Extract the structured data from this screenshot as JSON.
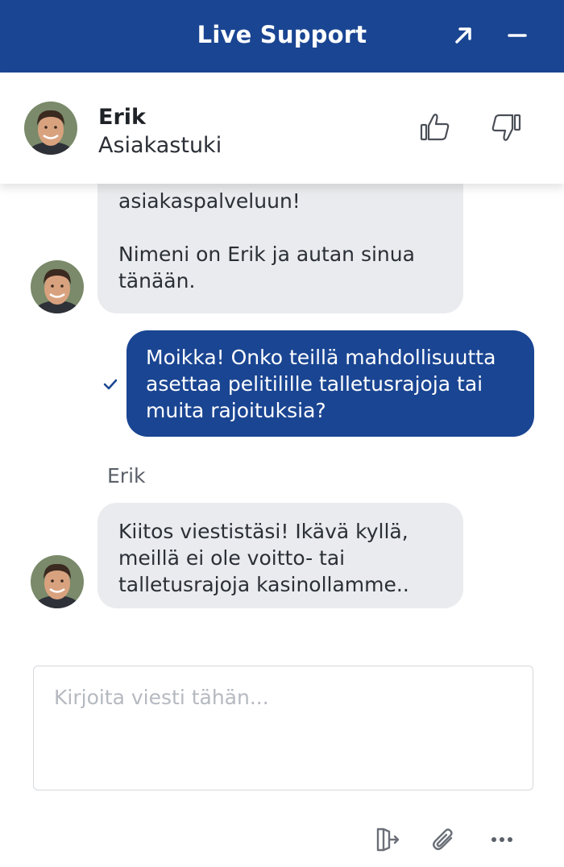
{
  "header": {
    "title": "Live Support",
    "icons": {
      "expand": "expand-arrow-icon",
      "minimize": "minimize-icon"
    },
    "background_color": "#1a4592"
  },
  "agent": {
    "name": "Erik",
    "role": "Asiakastuki",
    "icons": {
      "thumbs_up": "thumbs-up-icon",
      "thumbs_down": "thumbs-down-icon"
    }
  },
  "messages": [
    {
      "from": "agent",
      "lines": [
        "Hei! Tervetuloa live-asiakaspalveluun!",
        "Nimeni on Erik ja autan sinua tänään."
      ]
    },
    {
      "from": "user",
      "text": "Moikka! Onko teillä mahdollisuutta asettaa pelitilille talletusrajoja tai muita rajoituksia?",
      "status_icon": "checkmark-icon"
    },
    {
      "from": "agent",
      "sender_label": "Erik",
      "text": "Kiitos viestistäsi! Ikävä kyllä, meillä ei ole voitto- tai talletusrajoja kasinollamme.."
    }
  ],
  "composer": {
    "placeholder": "Kirjoita viesti tähän...",
    "value": ""
  },
  "toolbar": {
    "icons": [
      "exit-chat-icon",
      "paperclip-icon",
      "more-options-icon"
    ]
  },
  "colors": {
    "accent": "#1a4592",
    "agent_bubble": "#e9ebee"
  }
}
